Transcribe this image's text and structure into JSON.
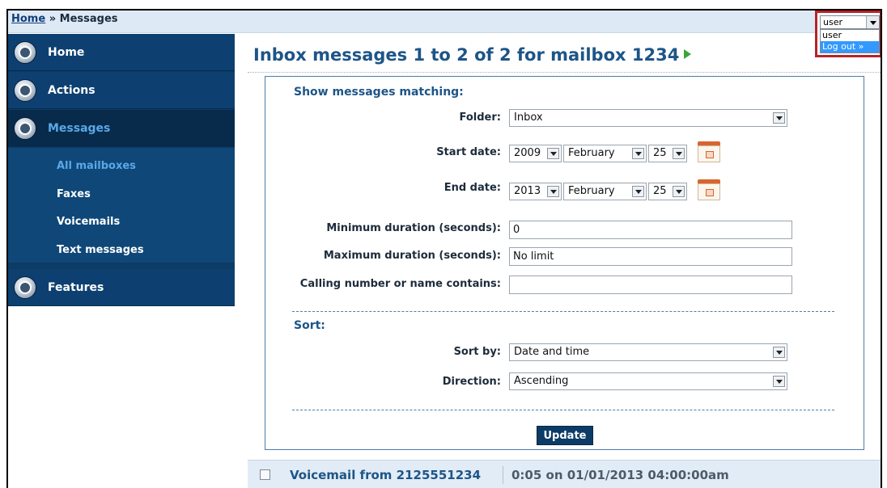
{
  "breadcrumb": {
    "home": "Home",
    "separator": "»",
    "current": "Messages"
  },
  "user_menu": {
    "selected": "user",
    "options": [
      "user",
      "Log out »"
    ]
  },
  "sidebar": {
    "items": [
      {
        "label": "Home",
        "icon": "home-icon"
      },
      {
        "label": "Actions",
        "icon": "actions-icon"
      },
      {
        "label": "Messages",
        "icon": "messages-icon",
        "active": true
      },
      {
        "label": "Features",
        "icon": "features-icon"
      }
    ],
    "sub_items": [
      {
        "label": "All mailboxes",
        "active": true
      },
      {
        "label": "Faxes"
      },
      {
        "label": "Voicemails"
      },
      {
        "label": "Text messages"
      }
    ]
  },
  "page_title": "Inbox messages 1 to 2 of 2 for mailbox 1234",
  "filter": {
    "heading": "Show messages matching:",
    "folder": {
      "label": "Folder:",
      "value": "Inbox"
    },
    "start_date": {
      "label": "Start date:",
      "year": "2009",
      "month": "February",
      "day": "25"
    },
    "end_date": {
      "label": "End date:",
      "year": "2013",
      "month": "February",
      "day": "25"
    },
    "min_duration": {
      "label": "Minimum duration (seconds):",
      "value": "0"
    },
    "max_duration": {
      "label": "Maximum duration (seconds):",
      "value": "No limit"
    },
    "calling": {
      "label": "Calling number or name contains:",
      "value": ""
    }
  },
  "sort": {
    "heading": "Sort:",
    "sort_by": {
      "label": "Sort by:",
      "value": "Date and time"
    },
    "direction": {
      "label": "Direction:",
      "value": "Ascending"
    }
  },
  "update_label": "Update",
  "messages": [
    {
      "title": "Voicemail from 2125551234",
      "meta": "0:05 on 01/01/2013 04:00:00am"
    }
  ],
  "colors": {
    "nav_bg": "#0d4070",
    "accent": "#1d5587",
    "active_nav": "#5aa8e8",
    "highlight_border": "#b5232a"
  }
}
